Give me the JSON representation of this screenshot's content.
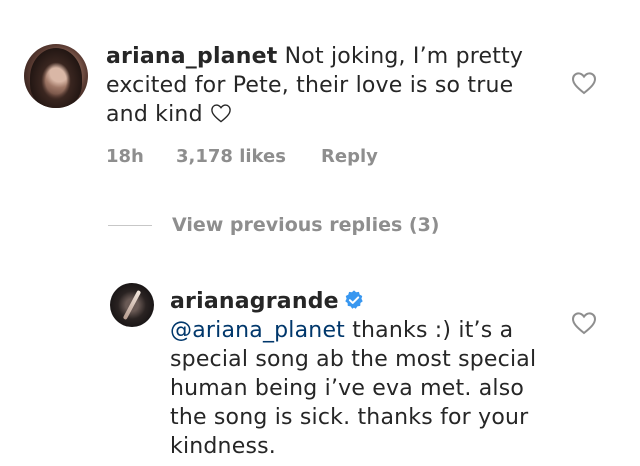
{
  "comment1": {
    "username": "ariana_planet",
    "text": " Not joking, I’m pretty excited for Pete, their love is so true and kind ",
    "time": "18h",
    "likes": "3,178 likes",
    "reply_label": "Reply"
  },
  "view_replies": "View previous replies (3)",
  "comment2": {
    "username": "arianagrande",
    "mention": "@ariana_planet",
    "text": " thanks :) it’s a special song ab the most special human being i’ve eva met. also the song is sick. thanks for your kindness."
  },
  "icons": {
    "like": "heart-outline-icon",
    "verified": "verified-badge-icon",
    "inline_heart": "heart-outline-icon"
  },
  "colors": {
    "text": "#262626",
    "meta": "#8e8e8e",
    "mention": "#00376b",
    "verified": "#3897f0"
  }
}
